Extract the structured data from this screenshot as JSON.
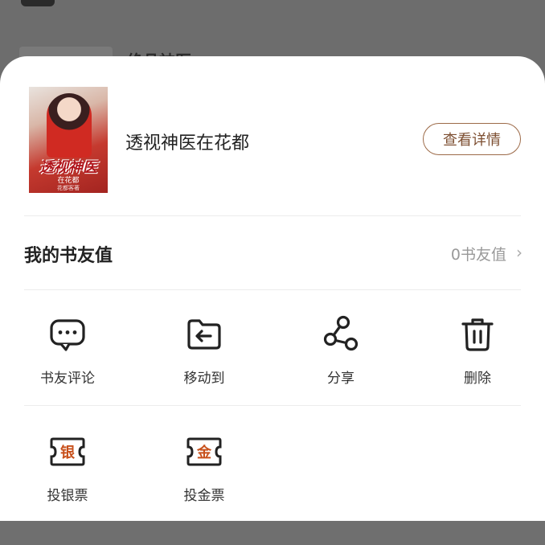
{
  "background": {
    "partial_title": "绝品神医"
  },
  "book": {
    "cover_title": "透视神医",
    "cover_subtitle": "在花都",
    "cover_author": "花都客著",
    "title": "透视神医在花都",
    "detail_button": "查看详情"
  },
  "book_friend": {
    "label": "我的书友值",
    "value": "0书友值"
  },
  "actions_row1": [
    {
      "label": "书友评论",
      "icon": "comment-icon"
    },
    {
      "label": "移动到",
      "icon": "move-folder-icon"
    },
    {
      "label": "分享",
      "icon": "share-icon"
    },
    {
      "label": "删除",
      "icon": "trash-icon"
    }
  ],
  "actions_row2": [
    {
      "label": "投银票",
      "icon": "silver-ticket-icon",
      "badge": "银"
    },
    {
      "label": "投金票",
      "icon": "gold-ticket-icon",
      "badge": "金"
    }
  ],
  "colors": {
    "accent": "#7d4f32",
    "ticket": "#c8511c"
  }
}
